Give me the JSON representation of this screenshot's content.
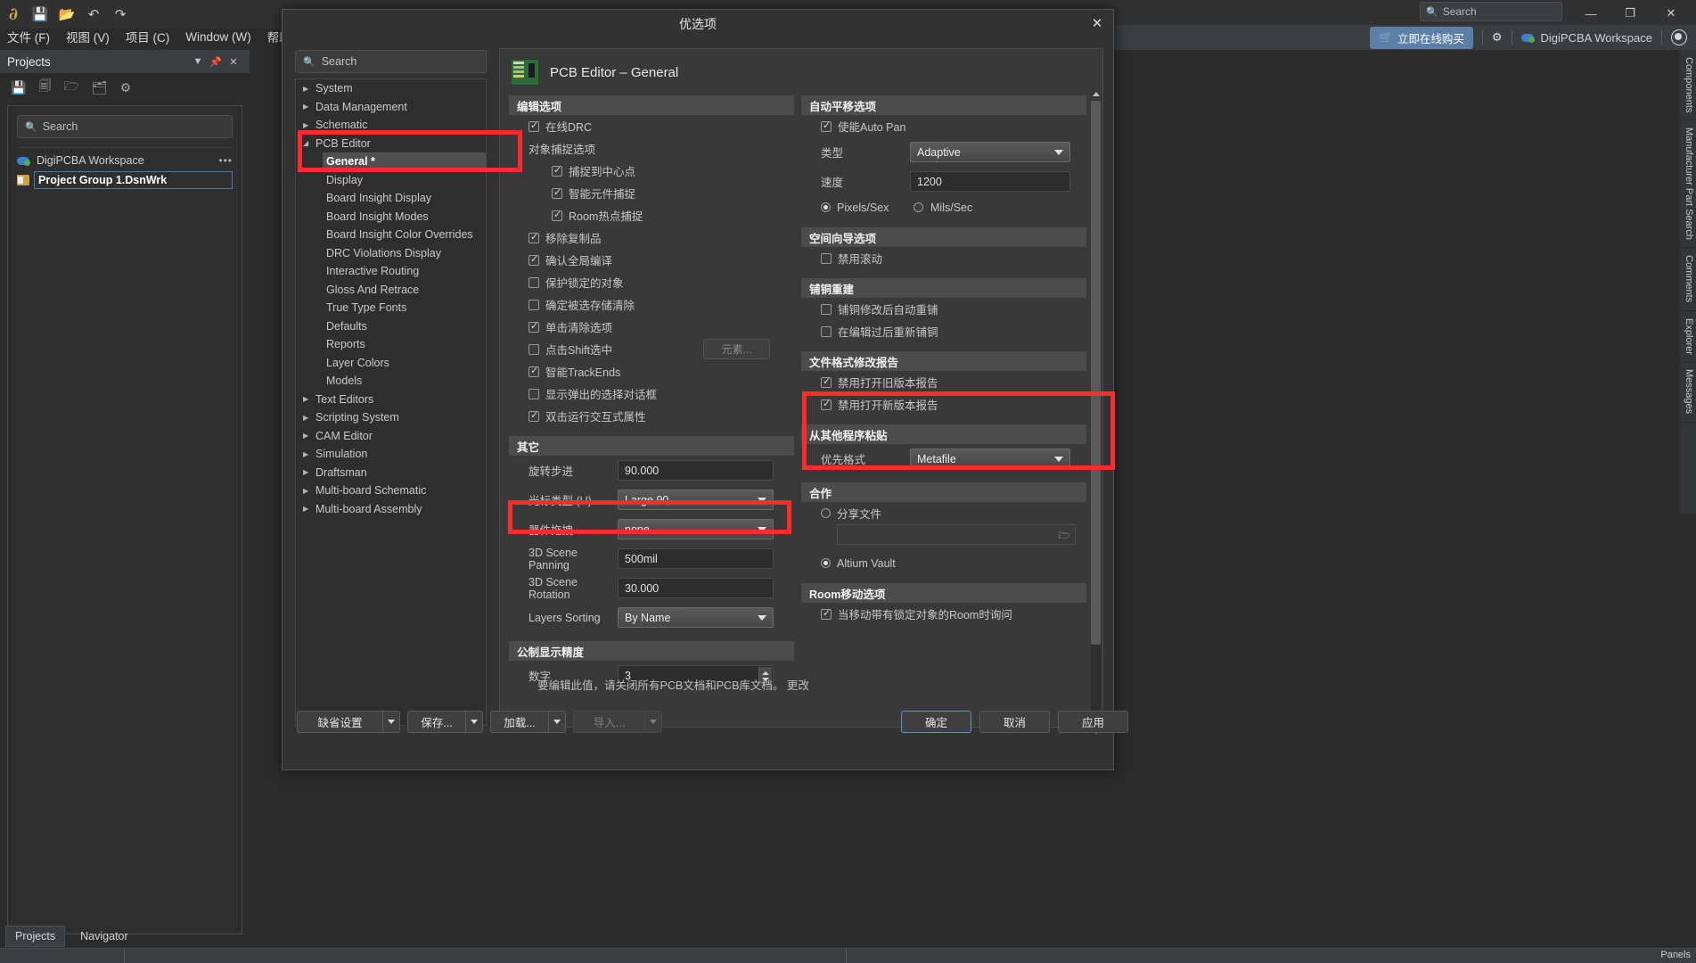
{
  "window": {
    "search_placeholder": "Search",
    "minimize": "—",
    "maximize": "❐",
    "close": "✕"
  },
  "menubar": [
    {
      "label": "文件 (F)"
    },
    {
      "label": "视图 (V)"
    },
    {
      "label": "项目 (C)"
    },
    {
      "label": "Window (W)"
    },
    {
      "label": "帮助 (H)"
    }
  ],
  "toolbar2": {
    "buy_label": "立即在线购买",
    "workspace_label": "DigiPCBA Workspace"
  },
  "projects_panel": {
    "title": "Projects",
    "search_placeholder": "Search",
    "items": [
      {
        "label": "DigiPCBA Workspace",
        "more": "•••"
      },
      {
        "label": "Project Group 1.DsnWrk"
      }
    ],
    "tabs": [
      {
        "label": "Projects",
        "active": true
      },
      {
        "label": "Navigator",
        "active": false
      }
    ]
  },
  "right_tabs": [
    "Components",
    "Manufacturer Part Search",
    "Comments",
    "Explorer",
    "Messages"
  ],
  "status_bar": {
    "panels_label": "Panels"
  },
  "dialog": {
    "title": "优选项",
    "close": "✕",
    "search_placeholder": "Search",
    "tree": [
      {
        "label": "System",
        "level": 0,
        "expandable": true,
        "expanded": false
      },
      {
        "label": "Data Management",
        "level": 0,
        "expandable": true,
        "expanded": false
      },
      {
        "label": "Schematic",
        "level": 0,
        "expandable": true,
        "expanded": false
      },
      {
        "label": "PCB Editor",
        "level": 0,
        "expandable": true,
        "expanded": true
      },
      {
        "label": "General *",
        "level": 1,
        "selected": true
      },
      {
        "label": "Display",
        "level": 1
      },
      {
        "label": "Board Insight Display",
        "level": 1
      },
      {
        "label": "Board Insight Modes",
        "level": 1
      },
      {
        "label": "Board Insight Color Overrides",
        "level": 1
      },
      {
        "label": "DRC Violations Display",
        "level": 1
      },
      {
        "label": "Interactive Routing",
        "level": 1
      },
      {
        "label": "Gloss And Retrace",
        "level": 1
      },
      {
        "label": "True Type Fonts",
        "level": 1
      },
      {
        "label": "Defaults",
        "level": 1
      },
      {
        "label": "Reports",
        "level": 1
      },
      {
        "label": "Layer Colors",
        "level": 1
      },
      {
        "label": "Models",
        "level": 1
      },
      {
        "label": "Text Editors",
        "level": 0,
        "expandable": true,
        "expanded": false
      },
      {
        "label": "Scripting System",
        "level": 0,
        "expandable": true,
        "expanded": false
      },
      {
        "label": "CAM Editor",
        "level": 0,
        "expandable": true,
        "expanded": false
      },
      {
        "label": "Simulation",
        "level": 0,
        "expandable": true,
        "expanded": false
      },
      {
        "label": "Draftsman",
        "level": 0,
        "expandable": true,
        "expanded": false
      },
      {
        "label": "Multi-board Schematic",
        "level": 0,
        "expandable": true,
        "expanded": false
      },
      {
        "label": "Multi-board Assembly",
        "level": 0,
        "expandable": true,
        "expanded": false
      }
    ],
    "page_title": "PCB Editor – General",
    "left_column": {
      "editing_options": {
        "header": "编辑选项",
        "online_drc": {
          "label": "在线DRC",
          "checked": true
        },
        "snap_group_label": "对象捕捉选项",
        "snap_center": {
          "label": "捕捉到中心点",
          "checked": true
        },
        "snap_smart": {
          "label": "智能元件捕捉",
          "checked": true
        },
        "snap_room": {
          "label": "Room热点捕捉",
          "checked": true
        },
        "remove_dup": {
          "label": "移除复制品",
          "checked": true
        },
        "confirm_global": {
          "label": "确认全局编译",
          "checked": true
        },
        "protect_locked": {
          "label": "保护锁定的对象",
          "checked": false
        },
        "confirm_mem_clear": {
          "label": "确定被选存储清除",
          "checked": false
        },
        "click_clears": {
          "label": "单击清除选项",
          "checked": true
        },
        "shift_click": {
          "label": "点击Shift选中",
          "checked": false,
          "button": "元素..."
        },
        "smart_trackends": {
          "label": "智能TrackEnds",
          "checked": true
        },
        "show_popup": {
          "label": "显示弹出的选择对话框",
          "checked": false
        },
        "dbl_click_props": {
          "label": "双击运行交互式属性",
          "checked": true
        }
      },
      "other": {
        "header": "其它",
        "rotation_step": {
          "label": "旋转步进",
          "value": "90.000"
        },
        "cursor_type": {
          "label": "光标类型 (U)",
          "value": "Large 90"
        },
        "comp_drag": {
          "label": "器件拖拽",
          "value": "none"
        },
        "scene_panning": {
          "label": "3D Scene Panning",
          "value": "500mil"
        },
        "scene_rotation": {
          "label": "3D Scene Rotation",
          "value": "30.000"
        },
        "layers_sorting": {
          "label": "Layers Sorting",
          "value": "By Name"
        }
      },
      "metric": {
        "header": "公制显示精度",
        "digits": {
          "label": "数字",
          "value": "3"
        },
        "note": "要编辑此值，请关闭所有PCB文档和PCB库文档。 更改"
      }
    },
    "right_column": {
      "autopan": {
        "header": "自动平移选项",
        "enable": {
          "label": "使能Auto Pan",
          "checked": true
        },
        "type": {
          "label": "类型",
          "value": "Adaptive"
        },
        "speed": {
          "label": "速度",
          "value": "1200"
        },
        "unit_pixels": {
          "label": "Pixels/Sex",
          "selected": true
        },
        "unit_mils": {
          "label": "Mils/Sec",
          "selected": false
        }
      },
      "space_navigator": {
        "header": "空间向导选项",
        "disable_roll": {
          "label": "禁用滚动",
          "checked": false
        }
      },
      "polygon_rebuild": {
        "header": "铺铜重建",
        "auto_rebuild": {
          "label": "铺铜修改后自动重铺",
          "checked": false
        },
        "repour_after_edit": {
          "label": "在编辑过后重新铺铜",
          "checked": false
        }
      },
      "file_format_report": {
        "header": "文件格式修改报告",
        "disable_old": {
          "label": "禁用打开旧版本报告",
          "checked": true
        },
        "disable_new": {
          "label": "禁用打开新版本报告",
          "checked": true
        }
      },
      "paste_from_other": {
        "header": "从其他程序粘贴",
        "priority_format": {
          "label": "优先格式",
          "value": "Metafile"
        }
      },
      "collaboration": {
        "header": "合作",
        "shared_file": {
          "label": "分享文件",
          "selected": false,
          "path": ""
        },
        "altium_vault": {
          "label": "Altium Vault",
          "selected": true
        }
      },
      "room_move": {
        "header": "Room移动选项",
        "ask_when_move": {
          "label": "当移动带有锁定对象的Room时询问",
          "checked": true
        }
      }
    },
    "footer": {
      "defaults": {
        "label": "缺省设置",
        "disabled": false
      },
      "save": {
        "label": "保存...",
        "disabled": false
      },
      "load": {
        "label": "加载...",
        "disabled": false
      },
      "import": {
        "label": "导入...",
        "disabled": true
      },
      "ok": {
        "label": "确定"
      },
      "cancel": {
        "label": "取消"
      },
      "apply": {
        "label": "应用"
      }
    }
  },
  "annotations": {
    "highlight_color": "#fc2b2b"
  }
}
